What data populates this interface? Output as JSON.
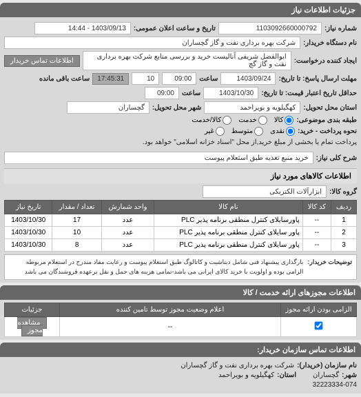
{
  "section1": {
    "title": "جزئیات اطلاعات نیاز",
    "req_no_label": "شماره نیاز:",
    "req_no": "1103092660000792",
    "announce_label": "تاریخ و ساعت اعلان عمومی:",
    "announce": "1403/09/13 - 14:44",
    "buyer_org_label": "نام دستگاه خریدار:",
    "buyer_org": "شرکت بهره برداری نفت و گاز گچساران",
    "requester_label": "ایجاد کننده درخواست:",
    "requester": "ابوالفضل شریفی آنالیست خرید و بررسی منابع شرکت بهره برداری نفت و گاز گچ",
    "contact_btn": "اطلاعات تماس خریدار",
    "deadline_send_label": "مهلت ارسال پاسخ: تا تاریخ:",
    "deadline_send_date": "1403/09/24",
    "time_label": "ساعت",
    "deadline_send_time": "09:00",
    "remaining": "10",
    "countdown": "17:45:31",
    "remaining_suffix": "ساعت باقی مانده",
    "validity_label": "حداقل تاریخ اعتبار قیمت: تا تاریخ:",
    "validity_date": "1403/10/30",
    "validity_time": "09:00",
    "province_label": "استان محل تحویل:",
    "province": "کهگیلویه و بویراحمد",
    "city_label": "شهر محل تحویل:",
    "city": "گچساران",
    "budget_type_label": "طبقه بندی موضوعی:",
    "budget_options": [
      "کالا",
      "خدمت",
      "کالا/خدمت"
    ],
    "budget_selected": 0,
    "payment_label": "نحوه پرداخت - خرید:",
    "payment_options": [
      "نقدی",
      "متوسط",
      "غیر"
    ],
    "payment_selected": 0,
    "payment_desc": "پرداخت تمام یا بخشی از مبلغ خرید,از محل \"اسناد خزانه اسلامی\" خواهد بود.",
    "general_desc_label": "شرح کلی نیاز:",
    "general_desc": "خرید منبع تغذیه طبق استعلام پیوست"
  },
  "section2": {
    "title": "اطلاعات کالاهای مورد نیاز",
    "group_label": "گروه کالا:",
    "group": "ابزارآلات الکتریکی",
    "cols": [
      "ردیف",
      "کد کالا",
      "نام کالا",
      "واحد شمارش",
      "تعداد / مقدار",
      "تاریخ نیاز"
    ],
    "rows": [
      {
        "idx": "1",
        "code": "--",
        "name": "پاورسایلای کنترل منطقی برنامه پذیر PLC",
        "unit": "عدد",
        "qty": "17",
        "date": "1403/10/30"
      },
      {
        "idx": "2",
        "code": "--",
        "name": "پاور سایلای کنترل منطقی برنامه پذیر PLC",
        "unit": "عدد",
        "qty": "10",
        "date": "1403/10/30"
      },
      {
        "idx": "3",
        "code": "--",
        "name": "پاور سایلای کنترل منطقی برنامه پذیر PLC",
        "unit": "عدد",
        "qty": "8",
        "date": "1403/10/30"
      }
    ],
    "note_label": "توضیحات خریدار:",
    "note": "بارگذاری پیشنهاد فنی شامل دیتاشیت و کاتالوگ طبق استعلام پیوست و رعایت مفاد مندرج در استعلام مربوطه الزامی بوده و اولویت با خرید کالای ایرانی می باشد-تمامی هزینه های حمل و نقل برعهده فروشندگان می باشد"
  },
  "section3": {
    "title": "اطلاعات مجوزهای ارائه خدمت / کالا",
    "cols": [
      "الزامی بودن ارائه مجوز",
      "اعلام وضعیت مجوز توسط تامین کننده",
      "جزئیات"
    ],
    "detail_btn": "مشاهده مجوز"
  },
  "section4": {
    "title": "اطلاعات تماس سازمان خریدار:",
    "org_label": "نام سازمان (خریدار):",
    "org": "شرکت بهره برداری نفت و گاز گچساران",
    "city_label": "شهر:",
    "city": "گچساران",
    "province_label": "استان:",
    "province": "کهگیلویه و بویراحمد",
    "phone": "32223334-074"
  }
}
